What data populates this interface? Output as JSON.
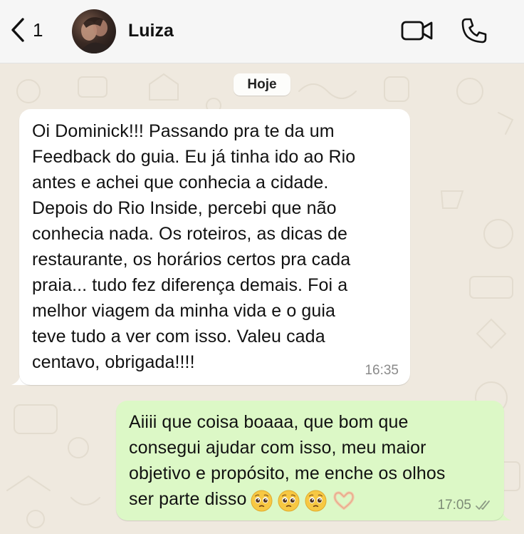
{
  "header": {
    "back_count": "1",
    "contact_name": "Luiza",
    "icons": [
      "chevron-left-icon",
      "video-camera-icon",
      "phone-icon"
    ]
  },
  "chat": {
    "date_label": "Hoje",
    "messages": [
      {
        "direction": "incoming",
        "text": "Oi Dominick!!! Passando pra te da um\nFeedback do guia. Eu já tinha ido ao Rio\nantes e achei que conhecia a cidade.\nDepois do Rio Inside, percebi que não\nconhecia nada. Os roteiros, as dicas de\nrestaurante, os horários certos pra cada\npraia... tudo fez diferença demais. Foi a\nmelhor viagem da minha vida e o guia\nteve tudo a ver com isso. Valeu cada\ncentavo, obrigada!!!!",
        "time": "16:35"
      },
      {
        "direction": "outgoing",
        "text": "Aiiii que coisa boaaa, que bom que\nconsegui ajudar com isso, meu maior\nobjetivo e propósito, me enche os olhos\nser parte disso",
        "emojis": "🥹🥹🥹🫶🏻",
        "time": "17:05",
        "status": "read"
      }
    ]
  },
  "colors": {
    "wallpaper": "#efe9df",
    "incoming_bubble": "#ffffff",
    "outgoing_bubble": "#dcf8c6",
    "header": "#f6f6f6",
    "read_check": "#8e9c86"
  }
}
